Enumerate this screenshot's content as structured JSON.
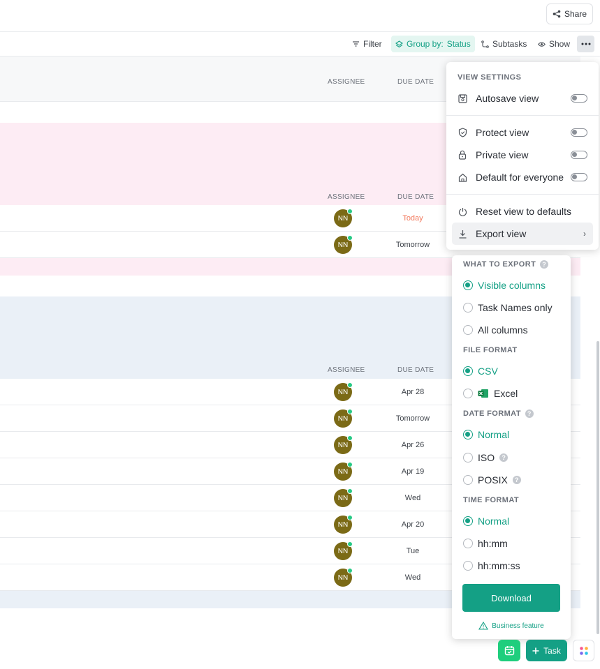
{
  "header": {
    "share_label": "Share"
  },
  "toolbar": {
    "filter_label": "Filter",
    "group_prefix": "Group by:",
    "group_value": "Status",
    "subtasks_label": "Subtasks",
    "show_label": "Show"
  },
  "columns": {
    "assignee": "ASSIGNEE",
    "due_date": "DUE DATE"
  },
  "groups": [
    {
      "color": "#fdecf4",
      "rows": []
    },
    {
      "color": "#fdecf4",
      "rows": [
        {
          "assignee": "NN",
          "due": "Today"
        },
        {
          "assignee": "NN",
          "due": "Tomorrow"
        }
      ]
    },
    {
      "color": "#eaf0f7",
      "rows": [
        {
          "assignee": "NN",
          "due": "Apr 28"
        },
        {
          "assignee": "NN",
          "due": "Tomorrow"
        },
        {
          "assignee": "NN",
          "due": "Apr 26"
        },
        {
          "assignee": "NN",
          "due": "Apr 19"
        },
        {
          "assignee": "NN",
          "due": "Wed"
        },
        {
          "assignee": "NN",
          "due": "Apr 20"
        },
        {
          "assignee": "NN",
          "due": "Tue"
        },
        {
          "assignee": "NN",
          "due": "Wed"
        }
      ]
    }
  ],
  "view_settings": {
    "title": "VIEW SETTINGS",
    "autosave": "Autosave view",
    "protect": "Protect view",
    "private": "Private view",
    "default_everyone": "Default for everyone",
    "reset": "Reset view to defaults",
    "export": "Export view"
  },
  "export": {
    "what_title": "WHAT TO EXPORT",
    "visible_columns": "Visible columns",
    "task_names": "Task Names only",
    "all_columns": "All columns",
    "file_title": "FILE FORMAT",
    "csv": "CSV",
    "excel": "Excel",
    "date_title": "DATE FORMAT",
    "date_normal": "Normal",
    "iso": "ISO",
    "posix": "POSIX",
    "time_title": "TIME FORMAT",
    "time_normal": "Normal",
    "hhmm": "hh:mm",
    "hhmmss": "hh:mm:ss",
    "download": "Download",
    "business": "Business feature"
  },
  "fab": {
    "task_label": "Task"
  },
  "colors": {
    "accent": "#14a085",
    "today": "#f27a5e",
    "avatar": "#7b6a16",
    "online": "#27c985"
  }
}
